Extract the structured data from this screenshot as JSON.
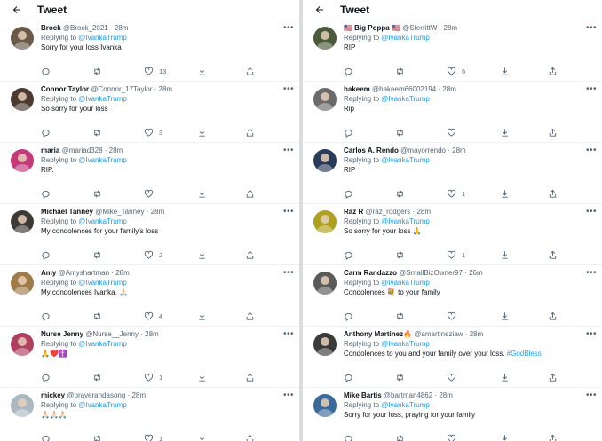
{
  "colors": {
    "accent": "#1d9bf0",
    "muted": "#536471"
  },
  "left_panel": {
    "title": "Tweet",
    "tweets": [
      {
        "name": "Brock",
        "handle": "@Brock_2021",
        "time": "28m",
        "replying_label": "Replying to",
        "mention": "@IvankaTrump",
        "text": "Sorry for your loss Ivanka",
        "likes": "13",
        "avatar": "#6b5a4a"
      },
      {
        "name": "Connor Taylor",
        "handle": "@Connor_17Taylor",
        "time": "28m",
        "replying_label": "Replying to",
        "mention": "@IvankaTrump",
        "text": "So sorry for your loss",
        "likes": "3",
        "avatar": "#4a3a30"
      },
      {
        "name": "maria",
        "handle": "@mariad328",
        "time": "28m",
        "replying_label": "Replying to",
        "mention": "@IvankaTrump",
        "text": "RIP.",
        "likes": "",
        "avatar": "#c23a7a"
      },
      {
        "name": "Michael Tanney",
        "handle": "@Mike_Tanney",
        "time": "28m",
        "replying_label": "Replying to",
        "mention": "@IvankaTrump",
        "text": "My condolences for your family's loss",
        "likes": "2",
        "avatar": "#3d3a36"
      },
      {
        "name": "Amy",
        "handle": "@Amyshartman",
        "time": "28m",
        "replying_label": "Replying to",
        "mention": "@IvankaTrump",
        "text": "My condolences Ivanka. 🙏🏻",
        "likes": "4",
        "avatar": "#a07b4a"
      },
      {
        "name": "Nurse Jenny",
        "handle": "@Nurse__Jenny",
        "time": "28m",
        "replying_label": "Replying to",
        "mention": "@IvankaTrump",
        "text": "🙏❤️✝️",
        "likes": "1",
        "avatar": "#b04060"
      },
      {
        "name": "mickey",
        "handle": "@prayerandasong",
        "time": "28m",
        "replying_label": "Replying to",
        "mention": "@IvankaTrump",
        "text": "🙏🏻🙏🏻🙏🏻",
        "likes": "1",
        "avatar": "#aab8c2"
      }
    ]
  },
  "right_panel": {
    "title": "Tweet",
    "tweets": [
      {
        "name": "🇺🇸 Big Poppa 🇺🇸",
        "handle": "@SterrittW",
        "time": "28m",
        "replying_label": "Replying to",
        "mention": "@IvankaTrump",
        "text": "RIP",
        "likes": "6",
        "avatar": "#4a5a3a"
      },
      {
        "name": "hakeem",
        "handle": "@hakeem66002194",
        "time": "28m",
        "replying_label": "Replying to",
        "mention": "@IvankaTrump",
        "text": "Rip",
        "likes": "",
        "avatar": "#6a6a6a"
      },
      {
        "name": "Carlos A. Rendo",
        "handle": "@mayorrendo",
        "time": "28m",
        "replying_label": "Replying to",
        "mention": "@IvankaTrump",
        "text": "RIP",
        "likes": "1",
        "avatar": "#2a3a5a"
      },
      {
        "name": "Raz R",
        "handle": "@raz_rodgers",
        "time": "28m",
        "replying_label": "Replying to",
        "mention": "@IvankaTrump",
        "text": "So sorry for your loss 🙏",
        "likes": "1",
        "avatar": "#b0a020"
      },
      {
        "name": "Carm Randazzo",
        "handle": "@SmallBizOwner97",
        "time": "26m",
        "replying_label": "Replying to",
        "mention": "@IvankaTrump",
        "text": "Condolences 💐 to your family",
        "likes": "",
        "avatar": "#5a5a5a"
      },
      {
        "name": "Anthony Martinez🔥",
        "handle": "@amartineziaw",
        "time": "28m",
        "replying_label": "Replying to",
        "mention": "@IvankaTrump",
        "text": "Condolences to you and your family over your loss.",
        "hashtag": "#GodBless",
        "likes": "",
        "avatar": "#3a3a3a"
      },
      {
        "name": "Mike Bartis",
        "handle": "@bartman4862",
        "time": "28m",
        "replying_label": "Replying to",
        "mention": "@IvankaTrump",
        "text": "Sorry for your loss, praying for your family",
        "likes": "",
        "avatar": "#3a6a9a"
      }
    ]
  }
}
